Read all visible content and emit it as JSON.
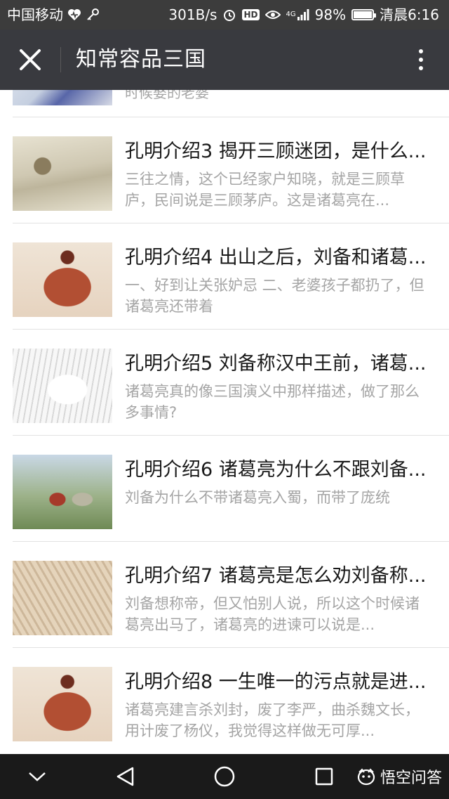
{
  "status_bar": {
    "carrier": "中国移动",
    "speed": "301B/s",
    "hd": "HD",
    "network": "4G",
    "battery_level": 0.98,
    "battery": "98%",
    "time": "清晨6:16"
  },
  "header": {
    "title": "知常容品三国"
  },
  "partial_item": {
    "desc": "时候娶的老婆"
  },
  "items": [
    {
      "title": "孔明介绍3 揭开三顾迷团，是什么...",
      "desc": "三往之情，这个已经家户知晓，就是三顾草庐，民间说是三顾茅庐。这是诸葛亮在...",
      "thumb": "art-sketch"
    },
    {
      "title": "孔明介绍4 出山之后，刘备和诸葛...",
      "desc": "一、好到让关张妒忌 二、老婆孩子都扔了，但诸葛亮还带着",
      "thumb": "art-red"
    },
    {
      "title": "孔明介绍5 刘备称汉中王前，诸葛...",
      "desc": "诸葛亮真的像三国演义中那样描述，做了那么多事情?",
      "thumb": "art-ink"
    },
    {
      "title": "孔明介绍6 诸葛亮为什么不跟刘备...",
      "desc": "刘备为什么不带诸葛亮入蜀，而带了庞统",
      "thumb": "art-land"
    },
    {
      "title": "孔明介绍7 诸葛亮是怎么劝刘备称...",
      "desc": "刘备想称帝，但又怕别人说，所以这个时候诸葛亮出马了，诸葛亮的进谏可以说是...",
      "thumb": "art-sepia"
    },
    {
      "title": "孔明介绍8 一生唯一的污点就是进...",
      "desc": "诸葛亮建言杀刘封，废了李严，曲杀魏文长，用计废了杨仪，我觉得这样做无可厚...",
      "thumb": "art-red"
    }
  ],
  "nav": {
    "brand_label": "悟空问答"
  },
  "colors": {
    "status_bg": "#3c3c3c",
    "header_bg": "#393a3f",
    "title_text": "#1a1a1a",
    "desc_text": "#a5a5a5",
    "nav_bg": "#1a1a1a"
  }
}
